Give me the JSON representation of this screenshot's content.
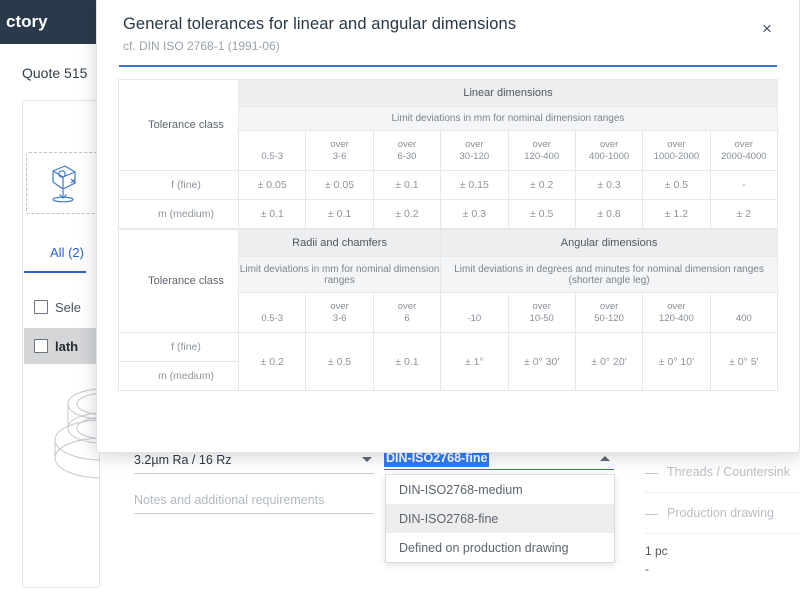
{
  "background": {
    "brand": "ctory",
    "quote_label": "Quote 515",
    "upload_icon": "upload-cad-icon",
    "tab_all": "All (2)",
    "select_all_label": "Sele",
    "part_row_label": "lath",
    "part_thumbnail": "lathe-part-3d-thumbnail"
  },
  "modal": {
    "title": "General tolerances for linear and angular dimensions",
    "subtitle": "cf. DIN ISO 2768-1 (1991-06)",
    "close_icon": "close-icon",
    "accent_color": "#3a6fd8"
  },
  "table_linear": {
    "class_header": "Tolerance class",
    "group_header": "Linear dimensions",
    "sub_header": "Limit deviations in mm for nominal dimension ranges",
    "range_prefix": "over",
    "ranges": [
      {
        "prefix": "",
        "value": "0.5-3"
      },
      {
        "prefix": "over",
        "value": "3-6"
      },
      {
        "prefix": "over",
        "value": "6-30"
      },
      {
        "prefix": "over",
        "value": "30-120"
      },
      {
        "prefix": "over",
        "value": "120-400"
      },
      {
        "prefix": "over",
        "value": "400-1000"
      },
      {
        "prefix": "over",
        "value": "1000-2000"
      },
      {
        "prefix": "over",
        "value": "2000-4000"
      }
    ],
    "rows": [
      {
        "label": "f (fine)",
        "values": [
          "± 0.05",
          "± 0.05",
          "± 0.1",
          "± 0.15",
          "± 0.2",
          "± 0.3",
          "± 0.5",
          "-"
        ]
      },
      {
        "label": "m (medium)",
        "values": [
          "± 0.1",
          "± 0.1",
          "± 0.2",
          "± 0.3",
          "± 0.5",
          "± 0.8",
          "± 1.2",
          "± 2"
        ]
      }
    ]
  },
  "table_angular": {
    "class_header": "Tolerance class",
    "group_header_left": "Radii and chamfers",
    "group_header_right": "Angular dimensions",
    "sub_header_left": "Limit deviations in mm for nominal dimension ranges",
    "sub_header_right": "Limit deviations in degrees and minutes for nominal dimension ranges (shorter angle leg)",
    "ranges": [
      {
        "prefix": "",
        "value": "0.5-3"
      },
      {
        "prefix": "over",
        "value": "3-6"
      },
      {
        "prefix": "over",
        "value": "6"
      },
      {
        "prefix": "",
        "value": "-10"
      },
      {
        "prefix": "over",
        "value": "10-50"
      },
      {
        "prefix": "over",
        "value": "50-120"
      },
      {
        "prefix": "over",
        "value": "120-400"
      },
      {
        "prefix": "",
        "value": "400"
      }
    ],
    "row_labels": [
      "f (fine)",
      "m (medium)"
    ],
    "values": [
      "± 0.2",
      "± 0.5",
      "± 0.1",
      "± 1°",
      "± 0° 30'",
      "± 0° 20'",
      "± 0° 10'",
      "± 0° 5'"
    ]
  },
  "form": {
    "roughness_value": "3.2µm Ra / 16 Rz",
    "notes_placeholder": "Notes and additional requirements",
    "tolerance_selected": "DIN-ISO2768-fine",
    "tolerance_options": [
      "DIN-ISO2768-medium",
      "DIN-ISO2768-fine",
      "Defined on production drawing"
    ],
    "selected_index": 1,
    "selection_highlight_color": "#2f7bf6"
  },
  "right_panel": {
    "rows": [
      {
        "marker": "—",
        "label": "Threads / Countersink"
      },
      {
        "marker": "—",
        "label": "Production drawing"
      }
    ],
    "quantity": "1 pc",
    "price": "-"
  }
}
